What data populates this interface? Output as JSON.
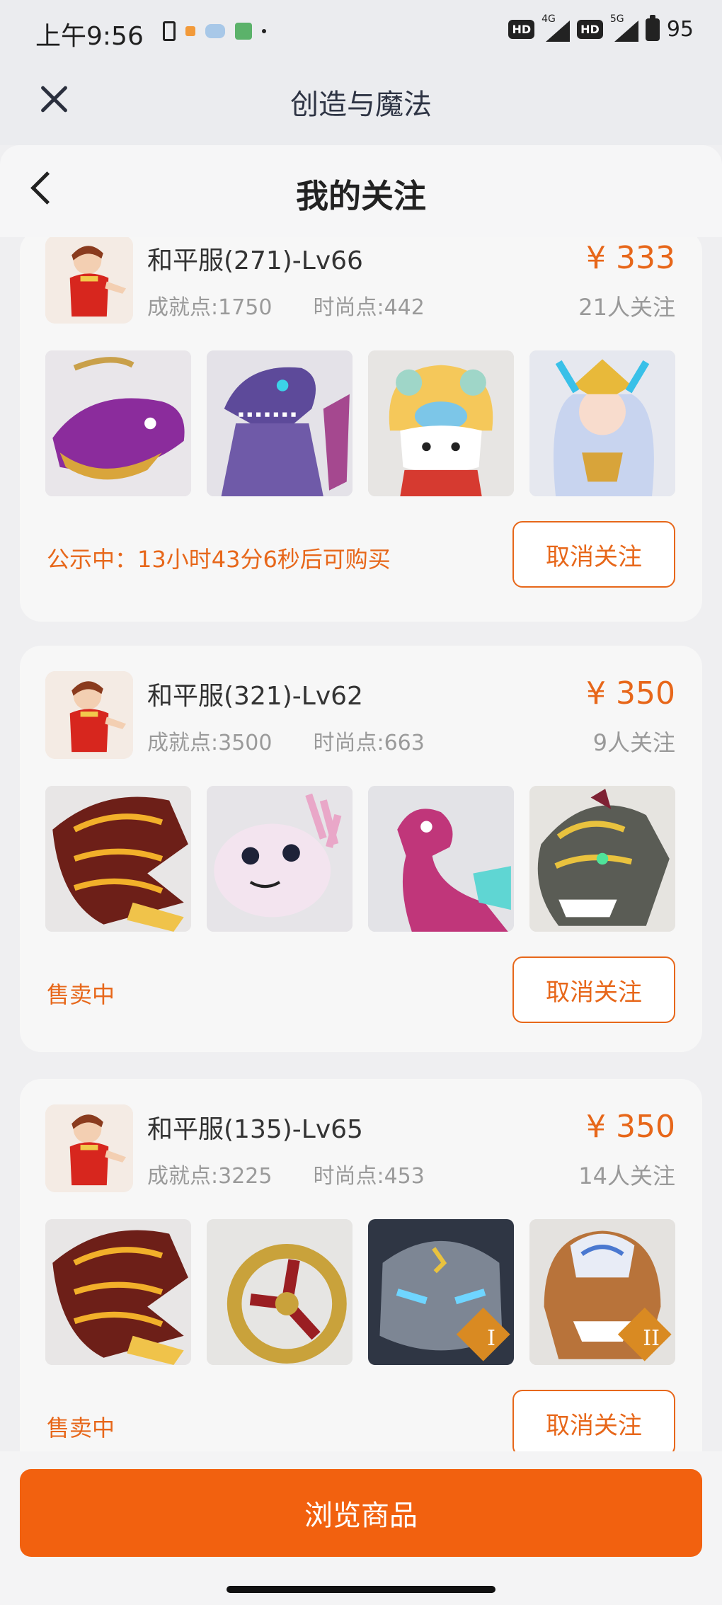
{
  "status_bar": {
    "time": "上午9:56",
    "network_1": "4G",
    "network_2": "5G",
    "hd_label": "HD",
    "battery": "95"
  },
  "app_header": {
    "title": "创造与魔法",
    "close_icon": "close-icon"
  },
  "page_header": {
    "title": "我的关注",
    "back_icon": "chevron-left-icon"
  },
  "listings": [
    {
      "name": "和平服(271)-Lv66",
      "achievement": "成就点:1750",
      "fashion": "时尚点:442",
      "price": "¥ 333",
      "followers": "21人关注",
      "status": "公示中：13小时43分6秒后可购买",
      "button": "取消关注",
      "items": [
        "purple-whale-mount",
        "purple-dinosaur-mount",
        "lion-dance-hat",
        "winged-crown-outfit"
      ]
    },
    {
      "name": "和平服(321)-Lv62",
      "achievement": "成就点:3500",
      "fashion": "时尚点:663",
      "price": "¥ 350",
      "followers": "9人关注",
      "status": "售卖中",
      "button": "取消关注",
      "items": [
        "fire-dragon-mount",
        "pink-axolotl-pet",
        "pink-dinosaur-pet",
        "armored-wolf-mount"
      ]
    },
    {
      "name": "和平服(135)-Lv65",
      "achievement": "成就点:3225",
      "fashion": "时尚点:453",
      "price": "¥ 350",
      "followers": "14人关注",
      "status": "售卖中",
      "button": "取消关注",
      "items": [
        "fire-dragon-mount",
        "golden-ring-item",
        "stone-golem-tier-1",
        "armored-lion-tier-2"
      ]
    }
  ],
  "tier_badges": [
    "I",
    "II"
  ],
  "bottom": {
    "browse_button": "浏览商品"
  },
  "colors": {
    "accent": "#e7671a",
    "primary_button": "#f2610f"
  }
}
